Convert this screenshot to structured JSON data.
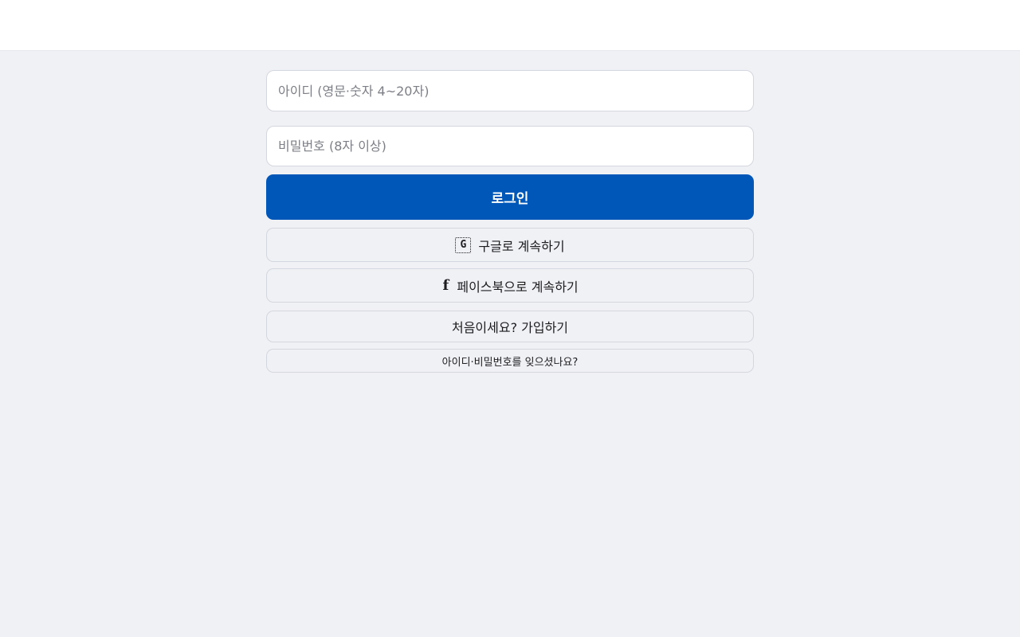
{
  "login": {
    "id_placeholder": "아이디 (영문·숫자 4~20자)",
    "password_placeholder": "비밀번호 (8자 이상)",
    "submit_label": "로그인",
    "google_label": "구글로 계속하기",
    "google_icon_glyph": "G",
    "facebook_label": "페이스북으로 계속하기",
    "facebook_icon_glyph": "f",
    "signup_label": "처음이세요? 가입하기",
    "forgot_label": "아이디·비밀번호를 잊으셨나요?"
  },
  "icons": {
    "google": "google-icon",
    "facebook": "facebook-icon"
  },
  "colors": {
    "primary": "#0057b8",
    "background": "#f0f1f5",
    "header": "#ffffff"
  }
}
